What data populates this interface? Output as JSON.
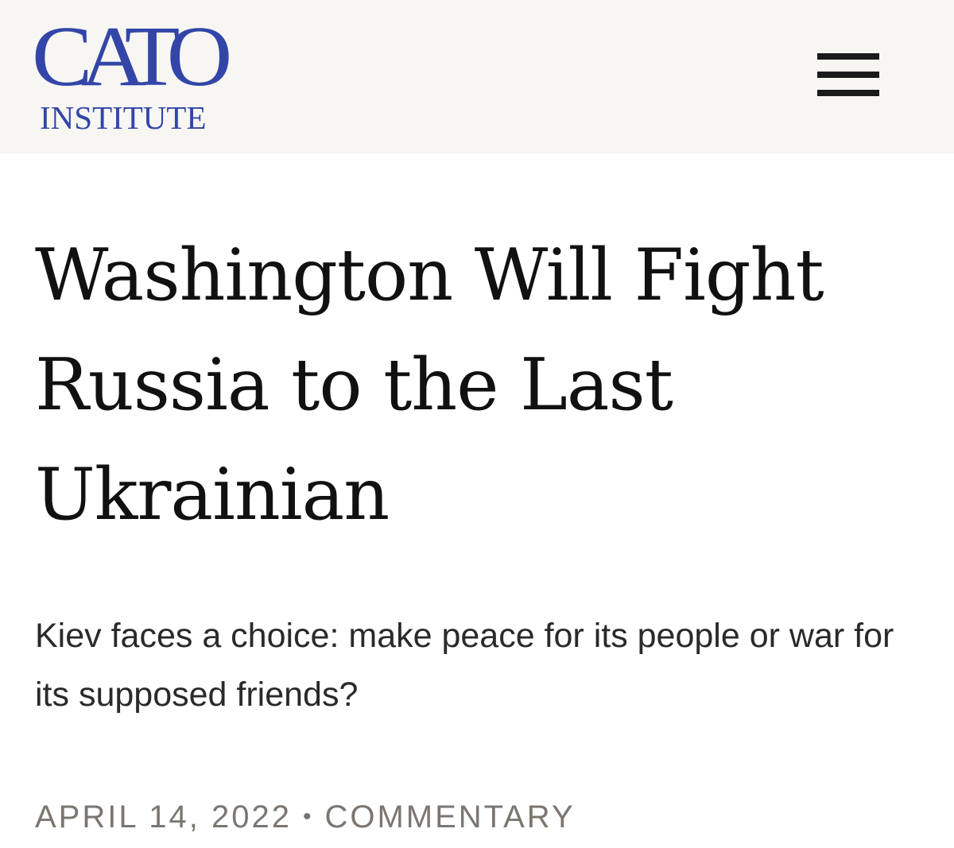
{
  "header": {
    "logo": {
      "main": "CATO",
      "sub": "INSTITUTE"
    },
    "menu_icon": "hamburger-menu-icon"
  },
  "article": {
    "title": "Washington Will Fight Russia to the Last Ukrainian",
    "subtitle": "Kiev faces a choice: make peace for its people or war for its supposed friends?",
    "date": "APRIL 14, 2022",
    "separator": "•",
    "category": "COMMENTARY"
  },
  "colors": {
    "brand": "#3346a8",
    "header_bg": "#f7f6f3",
    "meta_text": "#7c7670",
    "title_text": "#111111"
  }
}
